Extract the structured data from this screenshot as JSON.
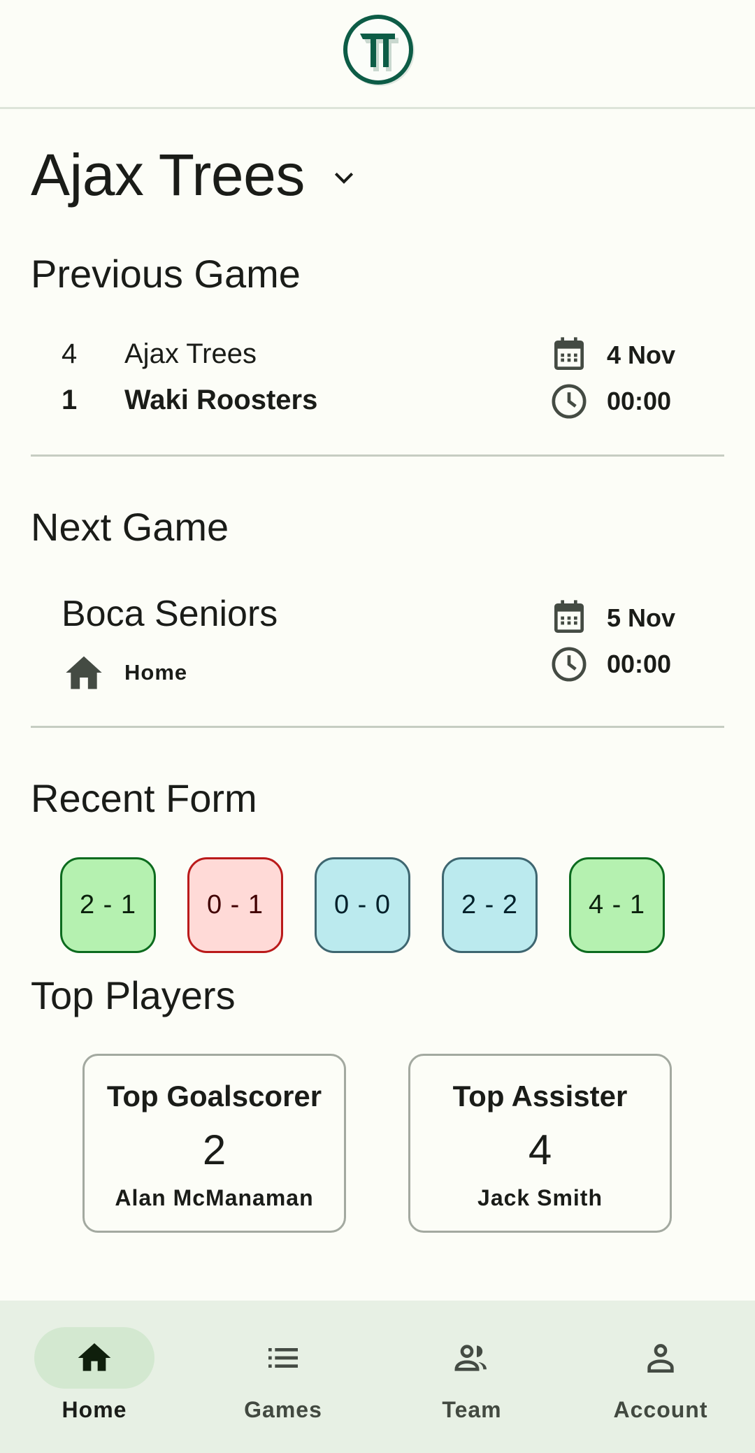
{
  "header": {
    "logo_icon": "team-logo-icon"
  },
  "team_selector": {
    "name": "Ajax Trees",
    "icon": "chevron-down-icon"
  },
  "previous_game": {
    "title": "Previous Game",
    "home": {
      "score": "4",
      "team": "Ajax Trees"
    },
    "away": {
      "score": "1",
      "team": "Waki Roosters"
    },
    "date": "4 Nov",
    "time": "00:00"
  },
  "next_game": {
    "title": "Next Game",
    "opponent": "Boca Seniors",
    "venue": "Home",
    "date": "5 Nov",
    "time": "00:00"
  },
  "recent_form": {
    "title": "Recent Form",
    "results": [
      {
        "score": "2 - 1",
        "result": "win"
      },
      {
        "score": "0 - 1",
        "result": "loss"
      },
      {
        "score": "0 - 0",
        "result": "draw"
      },
      {
        "score": "2 - 2",
        "result": "draw"
      },
      {
        "score": "4 - 1",
        "result": "win"
      }
    ]
  },
  "top_players": {
    "title": "Top Players",
    "goalscorer": {
      "label": "Top Goalscorer",
      "value": "2",
      "name": "Alan McManaman"
    },
    "assister": {
      "label": "Top Assister",
      "value": "4",
      "name": "Jack Smith"
    }
  },
  "nav": {
    "items": [
      {
        "label": "Home",
        "icon": "home-icon",
        "active": true
      },
      {
        "label": "Games",
        "icon": "list-icon",
        "active": false
      },
      {
        "label": "Team",
        "icon": "group-icon",
        "active": false
      },
      {
        "label": "Account",
        "icon": "person-icon",
        "active": false
      }
    ]
  },
  "colors": {
    "brand": "#0d5c46",
    "background": "#fcfdf7",
    "win_bg": "#b5f1b0",
    "win_border": "#0c6b1e",
    "loss_bg": "#ffdad7",
    "loss_border": "#ba1a1a",
    "draw_bg": "#bbeaee",
    "draw_border": "#3e6670",
    "nav_bg": "#e7f0e4",
    "nav_active": "#d3e8d0"
  }
}
